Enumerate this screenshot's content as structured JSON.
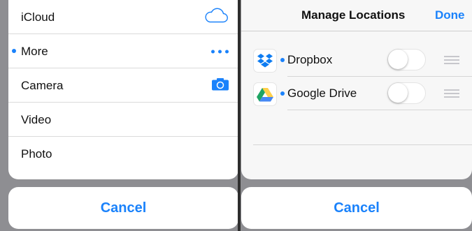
{
  "left_sheet": {
    "items": [
      {
        "label": "iCloud",
        "icon": "cloud-icon",
        "selected": false
      },
      {
        "label": "More",
        "icon": "more-icon",
        "selected": true
      },
      {
        "label": "Camera",
        "icon": "camera-icon",
        "selected": false
      },
      {
        "label": "Video",
        "icon": "",
        "selected": false
      },
      {
        "label": "Photo",
        "icon": "",
        "selected": false
      }
    ],
    "cancel_label": "Cancel"
  },
  "right_sheet": {
    "title": "Manage Locations",
    "done_label": "Done",
    "locations": [
      {
        "label": "Dropbox",
        "icon": "dropbox-icon",
        "enabled": false
      },
      {
        "label": "Google Drive",
        "icon": "google-drive-icon",
        "enabled": false
      }
    ],
    "cancel_label": "Cancel"
  },
  "colors": {
    "accent": "#1a82fb",
    "dropbox": "#0d7cf2",
    "drive_green": "#1fa463",
    "drive_yellow": "#ffd04b",
    "drive_blue": "#4688f4"
  }
}
